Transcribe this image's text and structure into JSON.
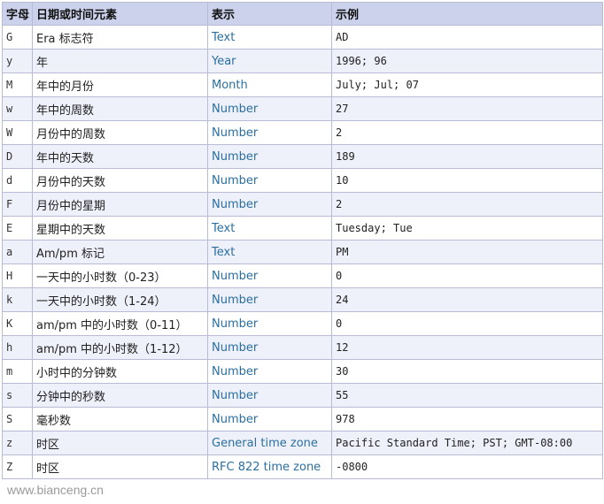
{
  "table": {
    "headers": {
      "letter": "字母",
      "element": "日期或时间元素",
      "representation": "表示",
      "example": "示例"
    },
    "rows": [
      {
        "letter": "G",
        "element": "Era 标志符",
        "representation": "Text",
        "example": "AD"
      },
      {
        "letter": "y",
        "element": "年",
        "representation": "Year",
        "example": "1996; 96"
      },
      {
        "letter": "M",
        "element": "年中的月份",
        "representation": "Month",
        "example": "July; Jul; 07"
      },
      {
        "letter": "w",
        "element": "年中的周数",
        "representation": "Number",
        "example": "27"
      },
      {
        "letter": "W",
        "element": "月份中的周数",
        "representation": "Number",
        "example": "2"
      },
      {
        "letter": "D",
        "element": "年中的天数",
        "representation": "Number",
        "example": "189"
      },
      {
        "letter": "d",
        "element": "月份中的天数",
        "representation": "Number",
        "example": "10"
      },
      {
        "letter": "F",
        "element": "月份中的星期",
        "representation": "Number",
        "example": "2"
      },
      {
        "letter": "E",
        "element": "星期中的天数",
        "representation": "Text",
        "example": "Tuesday; Tue"
      },
      {
        "letter": "a",
        "element": "Am/pm 标记",
        "representation": "Text",
        "example": "PM"
      },
      {
        "letter": "H",
        "element": "一天中的小时数（0-23）",
        "representation": "Number",
        "example": "0"
      },
      {
        "letter": "k",
        "element": "一天中的小时数（1-24）",
        "representation": "Number",
        "example": "24"
      },
      {
        "letter": "K",
        "element": "am/pm 中的小时数（0-11）",
        "representation": "Number",
        "example": "0"
      },
      {
        "letter": "h",
        "element": "am/pm 中的小时数（1-12）",
        "representation": "Number",
        "example": "12"
      },
      {
        "letter": "m",
        "element": "小时中的分钟数",
        "representation": "Number",
        "example": "30"
      },
      {
        "letter": "s",
        "element": "分钟中的秒数",
        "representation": "Number",
        "example": "55"
      },
      {
        "letter": "S",
        "element": "毫秒数",
        "representation": "Number",
        "example": "978"
      },
      {
        "letter": "z",
        "element": "时区",
        "representation": "General time zone",
        "example": "Pacific Standard Time; PST; GMT-08:00"
      },
      {
        "letter": "Z",
        "element": "时区",
        "representation": "RFC 822 time zone",
        "example": "-0800"
      }
    ]
  },
  "watermark": "www.bianceng.cn",
  "colors": {
    "header_bg": "#cdd2ec",
    "alt_row_bg": "#eef0fa",
    "representation_text": "#2a6fa0",
    "border": "#b8bcd2"
  }
}
